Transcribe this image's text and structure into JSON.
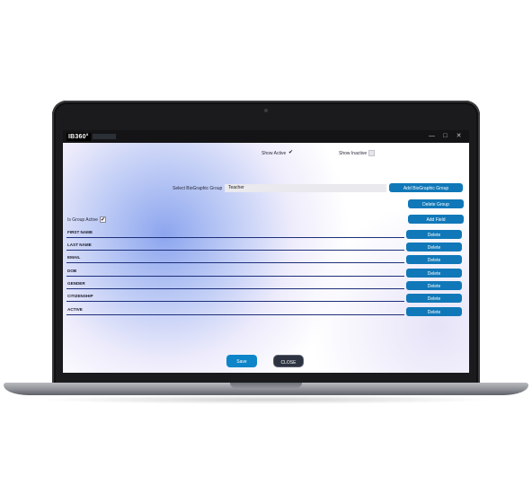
{
  "window": {
    "logo_text": "IB360°",
    "minimize": "—",
    "maximize": "□",
    "close": "✕"
  },
  "filters": {
    "show_active_label": "Show Active",
    "show_active_checked": "✔",
    "show_inactive_label": "Show Inactive"
  },
  "group": {
    "select_label": "Select BioGraphic Group",
    "selected_value": "Teacher",
    "add_group_label": "Add BioGraphic Group",
    "delete_group_label": "Delete Group",
    "is_active_label": "Is Group Active",
    "is_active_checked": "✔",
    "add_field_label": "Add Field"
  },
  "fields": [
    {
      "name": "FIRST NAME",
      "delete_label": "Delete"
    },
    {
      "name": "LAST NAME",
      "delete_label": "Delete"
    },
    {
      "name": "EMAIL",
      "delete_label": "Delete"
    },
    {
      "name": "DOB",
      "delete_label": "Delete"
    },
    {
      "name": "GENDER",
      "delete_label": "Delete"
    },
    {
      "name": "CITIZENSHIP",
      "delete_label": "Delete"
    },
    {
      "name": "ACTIVE",
      "delete_label": "Delete"
    }
  ],
  "footer": {
    "save_label": "Save",
    "close_label": "CLOSE"
  },
  "colors": {
    "primary_button": "#1078b8",
    "close_button": "#2d3340",
    "row_divider": "#1e2f7a"
  }
}
